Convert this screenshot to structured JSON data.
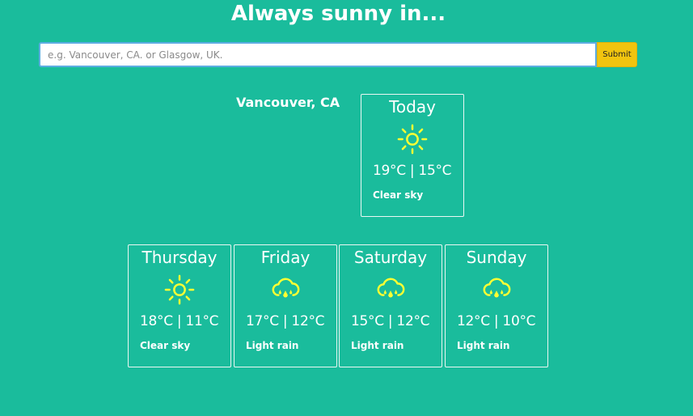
{
  "header": {
    "title": "Always sunny in..."
  },
  "search": {
    "placeholder": "e.g. Vancouver, CA. or Glasgow, UK.",
    "value": "",
    "submit_label": "Submit"
  },
  "location": "Vancouver, CA",
  "today": {
    "day": "Today",
    "icon": "sun-icon",
    "temps": "19°C | 15°C",
    "description": "Clear sky"
  },
  "forecast": [
    {
      "day": "Thursday",
      "icon": "sun-icon",
      "temps": "18°C | 11°C",
      "description": "Clear sky"
    },
    {
      "day": "Friday",
      "icon": "rain-cloud-icon",
      "temps": "17°C | 12°C",
      "description": "Light rain"
    },
    {
      "day": "Saturday",
      "icon": "rain-cloud-icon",
      "temps": "15°C | 12°C",
      "description": "Light rain"
    },
    {
      "day": "Sunday",
      "icon": "rain-cloud-icon",
      "temps": "12°C | 10°C",
      "description": "Light rain"
    }
  ],
  "colors": {
    "background": "#1abc9c",
    "accent": "#f1c40f",
    "icon": "#ffff33",
    "text": "#ffffff"
  }
}
